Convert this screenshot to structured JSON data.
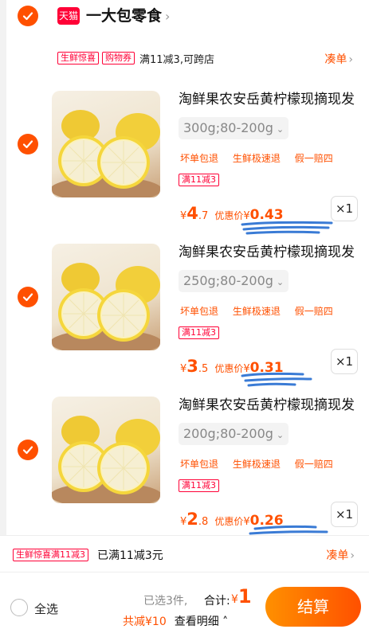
{
  "store": {
    "badge": "天猫",
    "name": "一大包零食",
    "promo_tags": [
      "生鲜惊喜",
      "购物券"
    ],
    "promo_text": "满11减3,可跨店",
    "coudan": "凑单"
  },
  "items": [
    {
      "title": "淘鲜果农安岳黄柠檬现摘现发",
      "sku": "300g;80-200g",
      "services": [
        "坏单包退",
        "生鲜极速退",
        "假一赔四"
      ],
      "promo_tag": "满11减3",
      "price_symbol": "¥",
      "price_int": "4",
      "price_dec": ".7",
      "discount_label": "优惠价",
      "discount_symbol": "¥",
      "discount_value": "0.43",
      "qty": "×1",
      "checked": true
    },
    {
      "title": "淘鲜果农安岳黄柠檬现摘现发",
      "sku": "250g;80-200g",
      "services": [
        "坏单包退",
        "生鲜极速退",
        "假一赔四"
      ],
      "promo_tag": "满11减3",
      "price_symbol": "¥",
      "price_int": "3",
      "price_dec": ".5",
      "discount_label": "优惠价",
      "discount_symbol": "¥",
      "discount_value": "0.31",
      "qty": "×1",
      "checked": true
    },
    {
      "title": "淘鲜果农安岳黄柠檬现摘现发",
      "sku": "200g;80-200g",
      "services": [
        "坏单包退",
        "生鲜极速退",
        "假一赔四"
      ],
      "promo_tag": "满11减3",
      "price_symbol": "¥",
      "price_int": "2",
      "price_dec": ".8",
      "discount_label": "优惠价",
      "discount_symbol": "¥",
      "discount_value": "0.26",
      "qty": "×1",
      "checked": true
    }
  ],
  "subtotal": {
    "tag": "生鲜惊喜满11减3",
    "text": "已满11减3元",
    "coudan": "凑单"
  },
  "footer": {
    "select_all": "全选",
    "selected": "已选3件,",
    "total_label": "合计:",
    "total_symbol": "¥",
    "total_value": "1",
    "discount": "共减¥10",
    "detail": "查看明细",
    "checkout": "结算"
  },
  "colors": {
    "accent": "#ff5000",
    "tag_red": "#ff0036",
    "scribble_blue": "#3a7bd5"
  }
}
